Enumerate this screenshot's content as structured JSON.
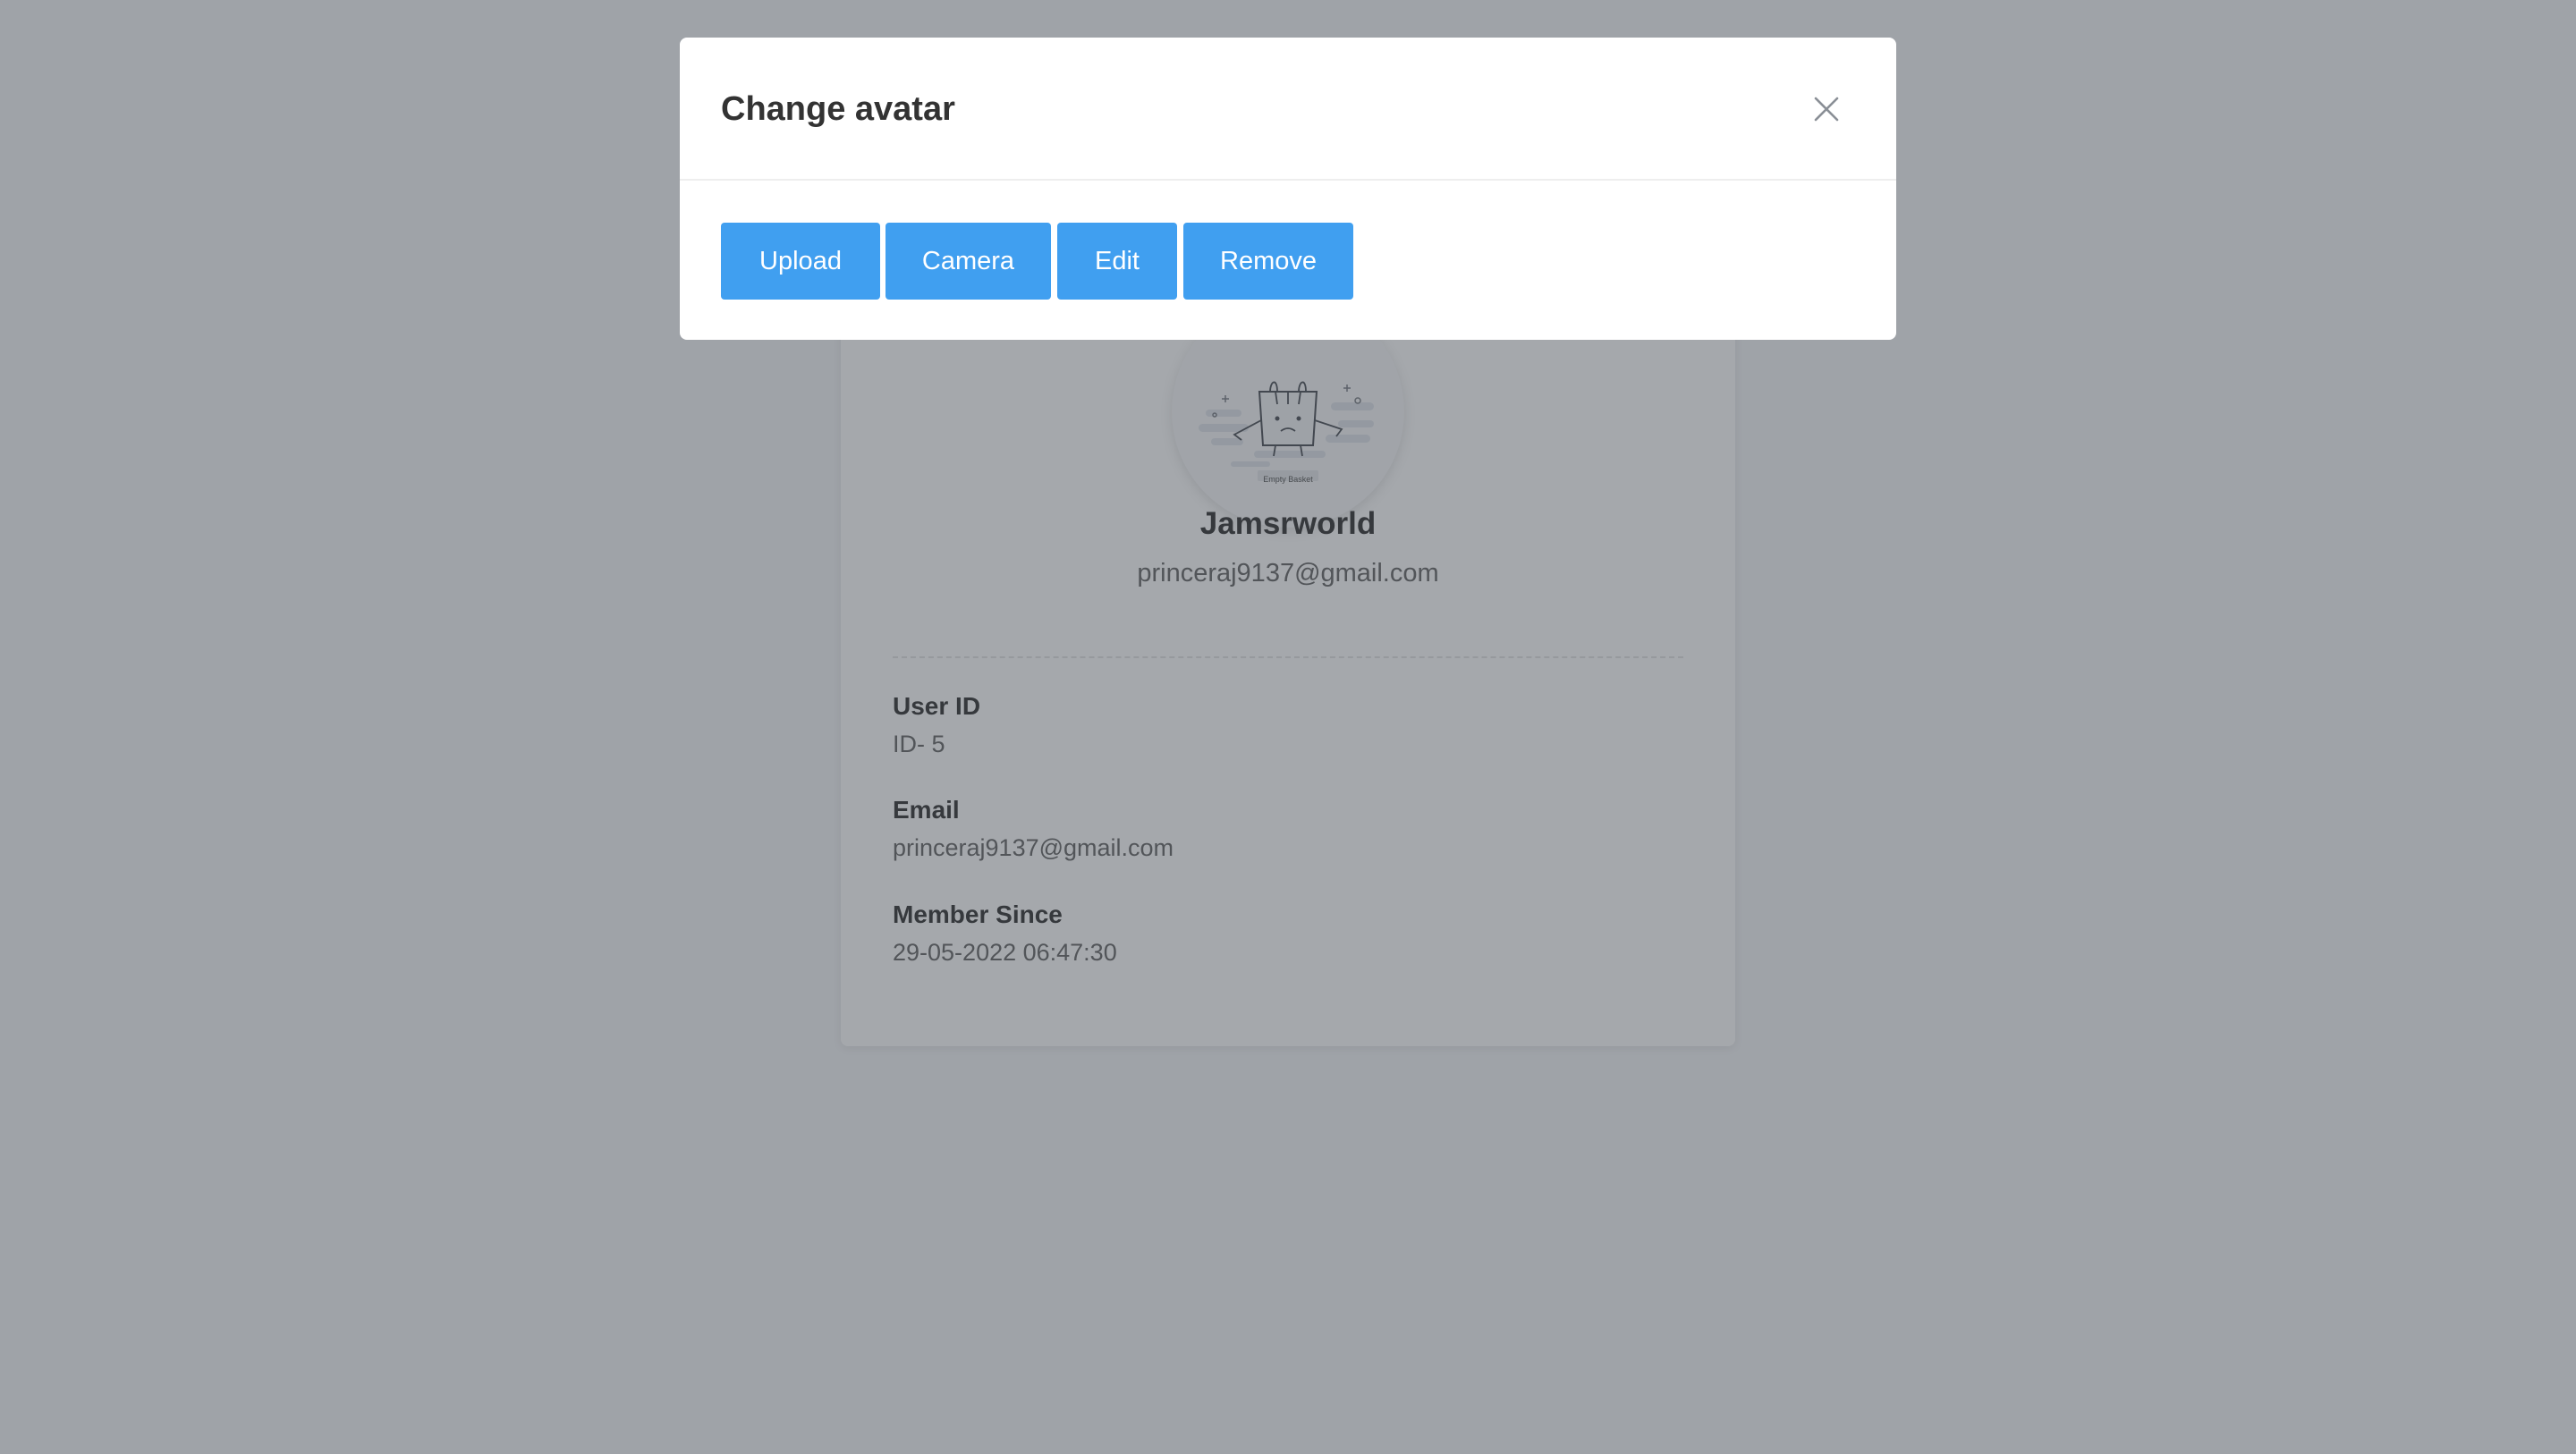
{
  "profile": {
    "avatar_caption": "Empty Basket",
    "name": "Jamsrworld",
    "email": "princeraj9137@gmail.com",
    "fields": [
      {
        "label": "User ID",
        "value": "ID- 5"
      },
      {
        "label": "Email",
        "value": "princeraj9137@gmail.com"
      },
      {
        "label": "Member Since",
        "value": "29-05-2022 06:47:30"
      }
    ]
  },
  "modal": {
    "title": "Change avatar",
    "close_icon": "close-icon",
    "buttons": {
      "upload": "Upload",
      "camera": "Camera",
      "edit": "Edit",
      "remove": "Remove"
    }
  },
  "colors": {
    "overlay": "#3a424a",
    "button": "#409ff0",
    "title": "#333333",
    "muted": "#666666"
  }
}
